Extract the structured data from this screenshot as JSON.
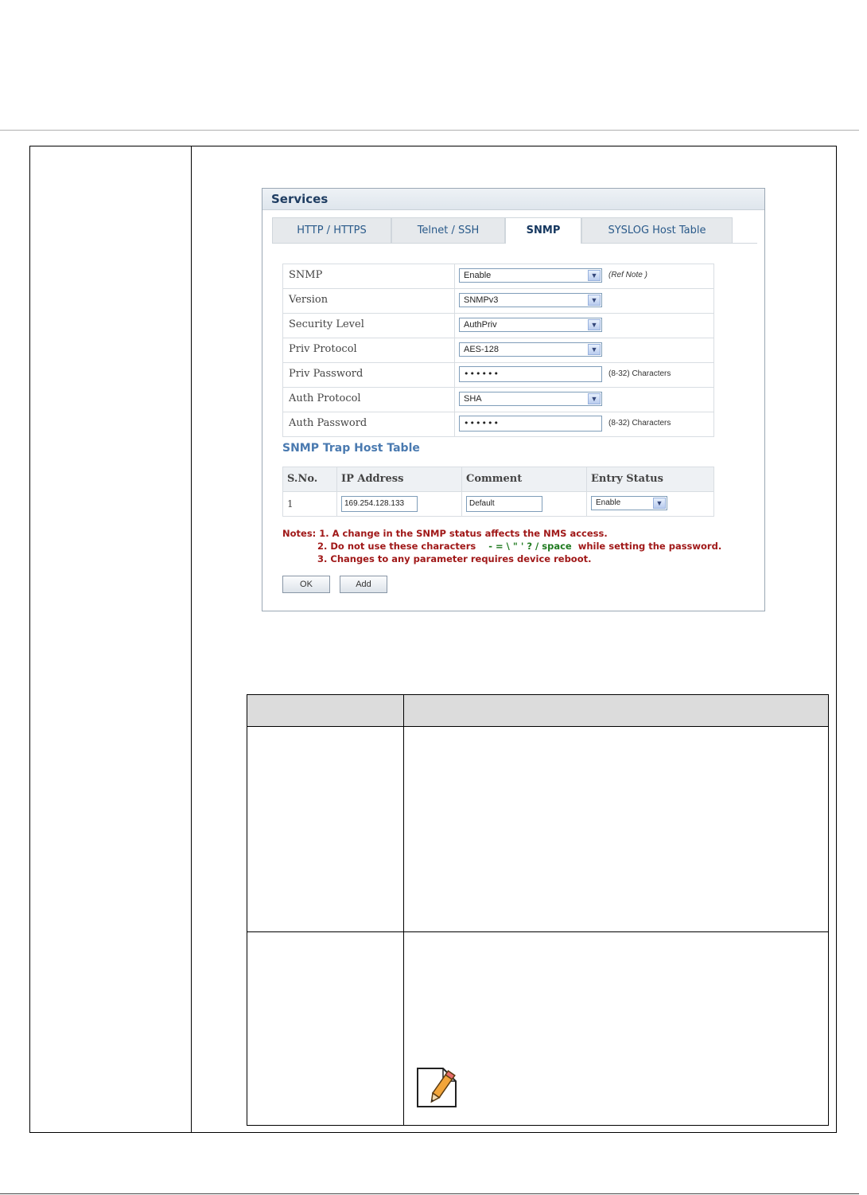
{
  "panel": {
    "title": "Services",
    "tabs": [
      {
        "label": "HTTP / HTTPS",
        "active": false
      },
      {
        "label": "Telnet / SSH",
        "active": false
      },
      {
        "label": "SNMP",
        "active": true
      },
      {
        "label": "SYSLOG Host Table",
        "active": false
      }
    ]
  },
  "form": {
    "rows": [
      {
        "label": "SNMP",
        "type": "select",
        "value": "Enable",
        "hint": "(Ref Note )"
      },
      {
        "label": "Version",
        "type": "select",
        "value": "SNMPv3",
        "hint": ""
      },
      {
        "label": "Security Level",
        "type": "select",
        "value": "AuthPriv",
        "hint": ""
      },
      {
        "label": "Priv Protocol",
        "type": "select",
        "value": "AES-128",
        "hint": ""
      },
      {
        "label": "Priv Password",
        "type": "password",
        "value": "••••••",
        "hint": "(8-32) Characters"
      },
      {
        "label": "Auth Protocol",
        "type": "select",
        "value": "SHA",
        "hint": ""
      },
      {
        "label": "Auth Password",
        "type": "password",
        "value": "••••••",
        "hint": "(8-32) Characters"
      }
    ]
  },
  "trap_table": {
    "title": "SNMP Trap Host Table",
    "headers": [
      "S.No.",
      "IP Address",
      "Comment",
      "Entry Status"
    ],
    "rows": [
      {
        "sno": "1",
        "ip": "169.254.128.133",
        "comment": "Default",
        "status": "Enable"
      }
    ]
  },
  "notes": {
    "line1": "Notes: 1. A change in the SNMP status affects the NMS access.",
    "line2_a": "2. Do not use these characters",
    "line2_chars": "- = \\ \" ' ? / space",
    "line2_b": "while setting the password.",
    "line3": "3. Changes to any parameter requires device reboot."
  },
  "buttons": {
    "ok": "OK",
    "add": "Add"
  }
}
